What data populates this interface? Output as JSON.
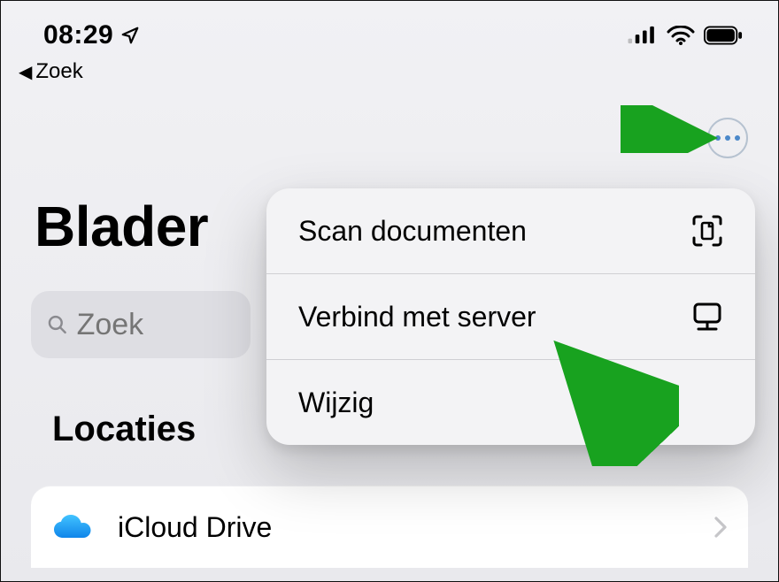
{
  "status": {
    "time": "08:29",
    "back_label": "Zoek"
  },
  "page": {
    "title": "Blader",
    "search_placeholder": "Zoek",
    "section_locations": "Locaties"
  },
  "menu": {
    "scan": "Scan documenten",
    "connect": "Verbind met server",
    "edit": "Wijzig"
  },
  "locations": {
    "icloud": "iCloud Drive"
  },
  "colors": {
    "accent": "#18a21f",
    "icloud_blue": "#1aa0f5"
  }
}
